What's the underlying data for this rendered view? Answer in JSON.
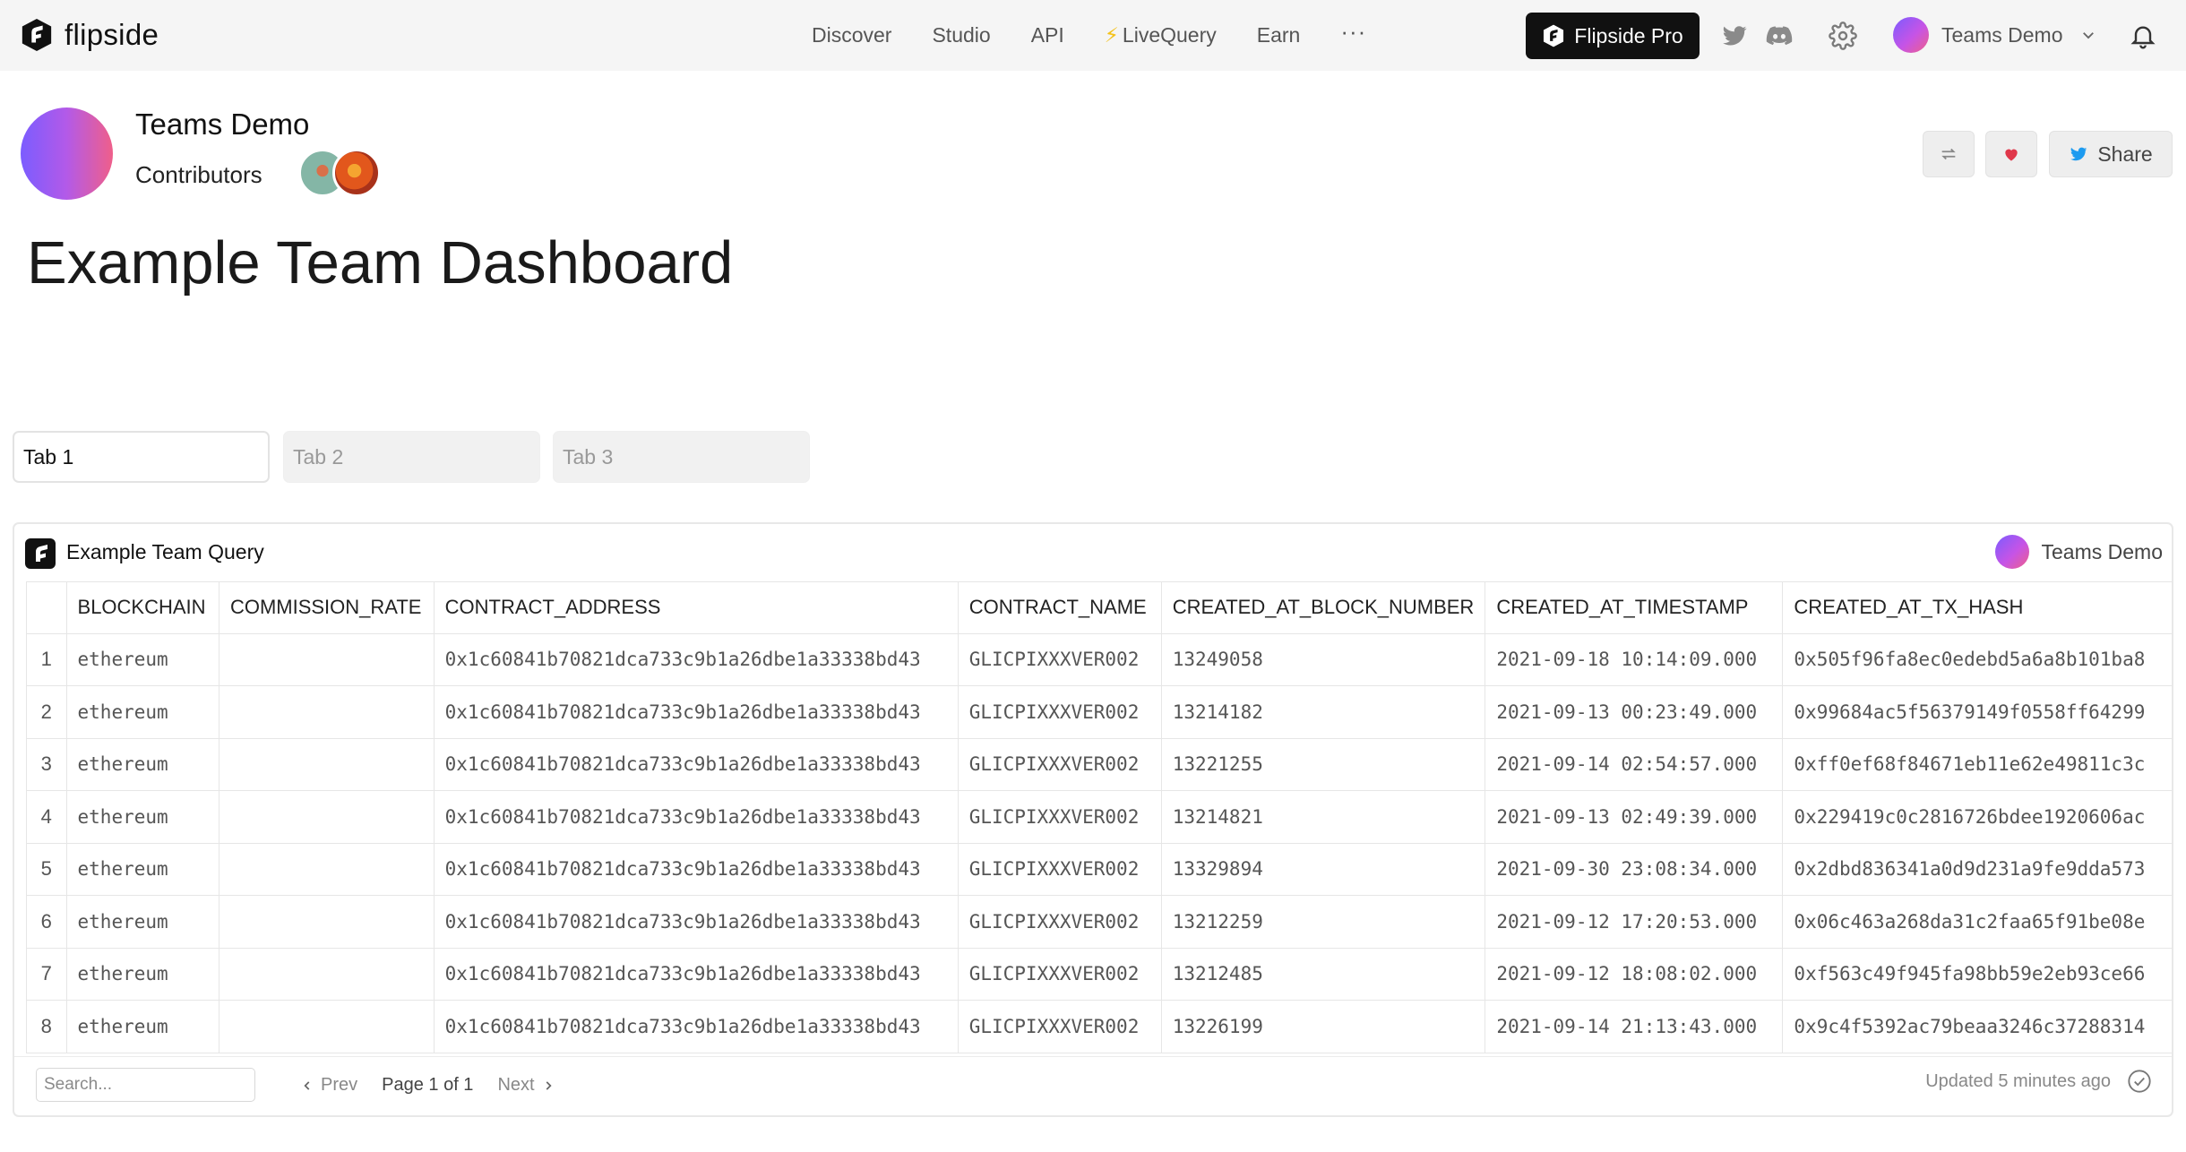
{
  "nav": {
    "brand": "flipside",
    "links": [
      "Discover",
      "Studio",
      "API",
      "LiveQuery",
      "Earn"
    ],
    "more": "···",
    "pro_label": "Flipside Pro",
    "user_name": "Teams Demo"
  },
  "header": {
    "team_name": "Teams Demo",
    "contributors_label": "Contributors",
    "share_label": "Share",
    "dashboard_title": "Example Team Dashboard"
  },
  "tabs": [
    "Tab 1",
    "Tab 2",
    "Tab 3"
  ],
  "query": {
    "title": "Example Team Query",
    "owner": "Teams Demo",
    "columns": [
      "BLOCKCHAIN",
      "COMMISSION_RATE",
      "CONTRACT_ADDRESS",
      "CONTRACT_NAME",
      "CREATED_AT_BLOCK_NUMBER",
      "CREATED_AT_TIMESTAMP",
      "CREATED_AT_TX_HASH"
    ],
    "rows": [
      [
        "1",
        "ethereum",
        "",
        "0x1c60841b70821dca733c9b1a26dbe1a33338bd43",
        "GLICPIXXXVER002",
        "13249058",
        "2021-09-18 10:14:09.000",
        "0x505f96fa8ec0edebd5a6a8b101ba8"
      ],
      [
        "2",
        "ethereum",
        "",
        "0x1c60841b70821dca733c9b1a26dbe1a33338bd43",
        "GLICPIXXXVER002",
        "13214182",
        "2021-09-13 00:23:49.000",
        "0x99684ac5f56379149f0558ff64299"
      ],
      [
        "3",
        "ethereum",
        "",
        "0x1c60841b70821dca733c9b1a26dbe1a33338bd43",
        "GLICPIXXXVER002",
        "13221255",
        "2021-09-14 02:54:57.000",
        "0xff0ef68f84671eb11e62e49811c3c"
      ],
      [
        "4",
        "ethereum",
        "",
        "0x1c60841b70821dca733c9b1a26dbe1a33338bd43",
        "GLICPIXXXVER002",
        "13214821",
        "2021-09-13 02:49:39.000",
        "0x229419c0c2816726bdee1920606ac"
      ],
      [
        "5",
        "ethereum",
        "",
        "0x1c60841b70821dca733c9b1a26dbe1a33338bd43",
        "GLICPIXXXVER002",
        "13329894",
        "2021-09-30 23:08:34.000",
        "0x2dbd836341a0d9d231a9fe9dda573"
      ],
      [
        "6",
        "ethereum",
        "",
        "0x1c60841b70821dca733c9b1a26dbe1a33338bd43",
        "GLICPIXXXVER002",
        "13212259",
        "2021-09-12 17:20:53.000",
        "0x06c463a268da31c2faa65f91be08e"
      ],
      [
        "7",
        "ethereum",
        "",
        "0x1c60841b70821dca733c9b1a26dbe1a33338bd43",
        "GLICPIXXXVER002",
        "13212485",
        "2021-09-12 18:08:02.000",
        "0xf563c49f945fa98bb59e2eb93ce66"
      ],
      [
        "8",
        "ethereum",
        "",
        "0x1c60841b70821dca733c9b1a26dbe1a33338bd43",
        "GLICPIXXXVER002",
        "13226199",
        "2021-09-14 21:13:43.000",
        "0x9c4f5392ac79beaa3246c37288314"
      ]
    ],
    "search_placeholder": "Search...",
    "prev_label": "Prev",
    "page_indicator": "Page 1 of 1",
    "next_label": "Next",
    "updated_label": "Updated 5 minutes ago"
  },
  "icons": {
    "brand": "flipside-logo-icon",
    "twitter": "twitter-icon",
    "discord": "discord-icon",
    "settings": "gear-icon",
    "bell": "bell-icon",
    "refresh": "refresh-icon",
    "like": "heart-icon",
    "check": "check-circle-icon"
  },
  "colors": {
    "accent_gradient_start": "#7b5cff",
    "accent_gradient_end": "#ef5f8a",
    "like": "#e0374a",
    "twitter": "#1d9bf0"
  }
}
